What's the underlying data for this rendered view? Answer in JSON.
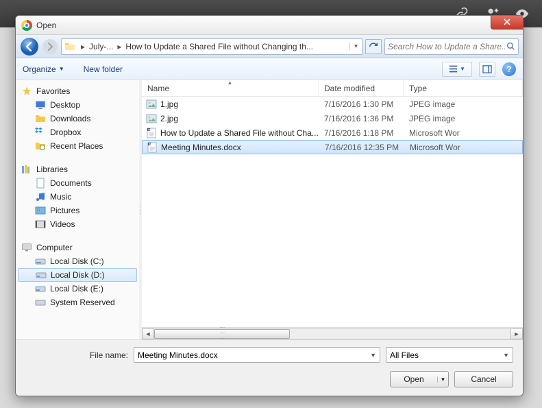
{
  "dialog": {
    "title": "Open"
  },
  "breadcrumb": {
    "seg1": "July-...",
    "seg2": "How to Update a Shared File without Changing th..."
  },
  "search": {
    "placeholder": "Search How to Update a Share..."
  },
  "toolbar": {
    "organize": "Organize",
    "newfolder": "New folder"
  },
  "columns": {
    "name": "Name",
    "date": "Date modified",
    "type": "Type"
  },
  "sidebar": {
    "favorites": {
      "label": "Favorites",
      "items": [
        {
          "label": "Desktop"
        },
        {
          "label": "Downloads"
        },
        {
          "label": "Dropbox"
        },
        {
          "label": "Recent Places"
        }
      ]
    },
    "libraries": {
      "label": "Libraries",
      "items": [
        {
          "label": "Documents"
        },
        {
          "label": "Music"
        },
        {
          "label": "Pictures"
        },
        {
          "label": "Videos"
        }
      ]
    },
    "computer": {
      "label": "Computer",
      "items": [
        {
          "label": "Local Disk (C:)"
        },
        {
          "label": "Local Disk (D:)"
        },
        {
          "label": "Local Disk (E:)"
        },
        {
          "label": "System Reserved"
        }
      ]
    }
  },
  "files": [
    {
      "name": "1.jpg",
      "date": "7/16/2016 1:30 PM",
      "type": "JPEG image",
      "kind": "img"
    },
    {
      "name": "2.jpg",
      "date": "7/16/2016 1:36 PM",
      "type": "JPEG image",
      "kind": "img"
    },
    {
      "name": "How to Update a Shared File without Cha...",
      "date": "7/16/2016 1:18 PM",
      "type": "Microsoft Wor",
      "kind": "doc"
    },
    {
      "name": "Meeting Minutes.docx",
      "date": "7/16/2016 12:35 PM",
      "type": "Microsoft Wor",
      "kind": "doc",
      "selected": true
    }
  ],
  "bottom": {
    "filename_label": "File name:",
    "filename_value": "Meeting Minutes.docx",
    "filter_value": "All Files",
    "open": "Open",
    "cancel": "Cancel"
  }
}
